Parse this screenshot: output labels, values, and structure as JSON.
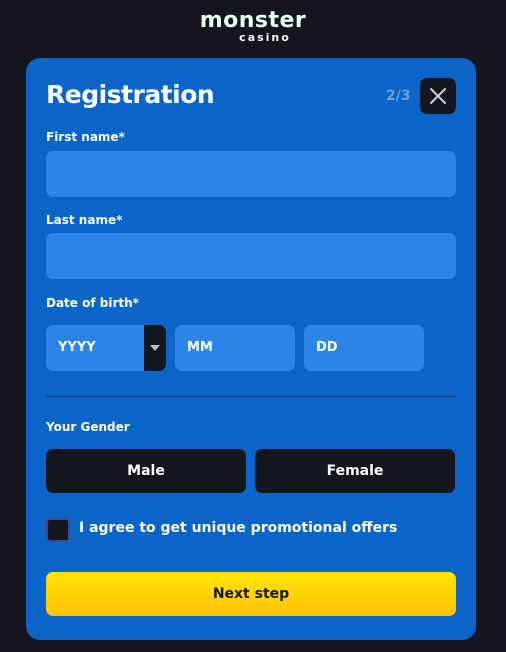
{
  "brand": {
    "name": "monster",
    "subname": "casino"
  },
  "form": {
    "title": "Registration",
    "step": "2/3",
    "first_name_label": "First name*",
    "first_name_value": "",
    "last_name_label": "Last name*",
    "last_name_value": "",
    "dob_label": "Date of birth*",
    "dob_year_placeholder": "YYYY",
    "dob_month_placeholder": "MM",
    "dob_day_placeholder": "DD",
    "gender_label": "Your Gender",
    "gender_options": [
      "Male",
      "Female"
    ],
    "promo_checked": false,
    "promo_label": "I agree to get unique promotional offers",
    "next_label": "Next step"
  },
  "icons": {
    "close": "close-icon",
    "dropdown": "caret-down-icon"
  },
  "colors": {
    "background": "#15161d",
    "card": "#0b65c9",
    "field": "#2b85e6",
    "dark": "#14161e",
    "accent_yellow": "#ffd600"
  }
}
